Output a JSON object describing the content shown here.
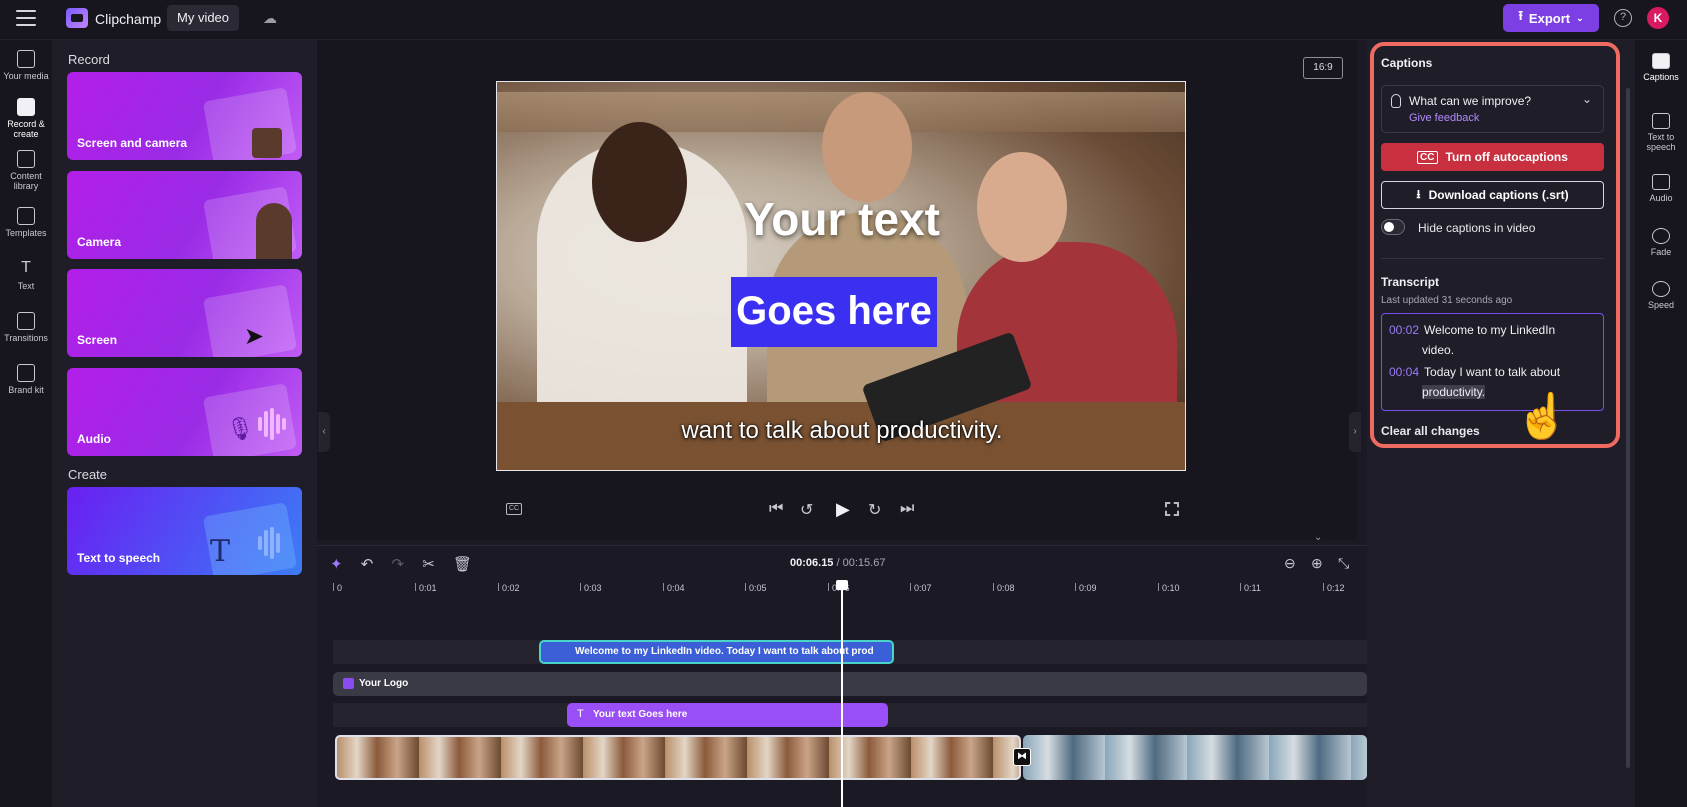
{
  "app": {
    "name": "Clipchamp",
    "project_name": "My video",
    "export_label": "Export",
    "avatar_initial": "K"
  },
  "left_nav": [
    {
      "label": "Your media"
    },
    {
      "label": "Record & create"
    },
    {
      "label": "Content library"
    },
    {
      "label": "Templates"
    },
    {
      "label": "Text"
    },
    {
      "label": "Transitions"
    },
    {
      "label": "Brand kit"
    }
  ],
  "media_panel": {
    "record_title": "Record",
    "create_title": "Create",
    "cards": [
      {
        "label": "Screen and camera"
      },
      {
        "label": "Camera"
      },
      {
        "label": "Screen"
      },
      {
        "label": "Audio"
      },
      {
        "label": "Text to speech"
      }
    ]
  },
  "preview": {
    "aspect_ratio": "16:9",
    "overlay_title": "Your text",
    "overlay_highlight": "Goes here",
    "caption": "want to talk about productivity.",
    "cc_label": "CC"
  },
  "timeline": {
    "current_time": "00:06.15",
    "total_time": "/ 00:15.67",
    "ticks": [
      "0",
      "0:01",
      "0:02",
      "0:03",
      "0:04",
      "0:05",
      "0:06",
      "0:07",
      "0:08",
      "0:09",
      "0:10",
      "0:11",
      "0:12"
    ],
    "caption_clip": "Welcome to my LinkedIn video. Today I want to talk about prod",
    "logo_clip": "Your Logo",
    "text_clip": "Your text Goes here"
  },
  "captions_panel": {
    "title": "Captions",
    "feedback_question": "What can we improve?",
    "feedback_link": "Give feedback",
    "turn_off_button": "Turn off autocaptions",
    "download_button": "Download captions (.srt)",
    "hide_toggle_label": "Hide captions in video",
    "hide_toggle_on": false,
    "transcript_title": "Transcript",
    "last_updated": "Last updated 31 seconds ago",
    "transcript": [
      {
        "time": "00:02",
        "line1": "Welcome to my LinkedIn",
        "line2": "video."
      },
      {
        "time": "00:04",
        "line1": "Today I want to talk about",
        "line2": "productivity."
      }
    ],
    "clear_link": "Clear all changes",
    "accent_highlight": "#ef6b62"
  },
  "right_nav": [
    {
      "label": "Captions"
    },
    {
      "label": "Text to speech"
    },
    {
      "label": "Audio"
    },
    {
      "label": "Fade"
    },
    {
      "label": "Speed"
    }
  ]
}
